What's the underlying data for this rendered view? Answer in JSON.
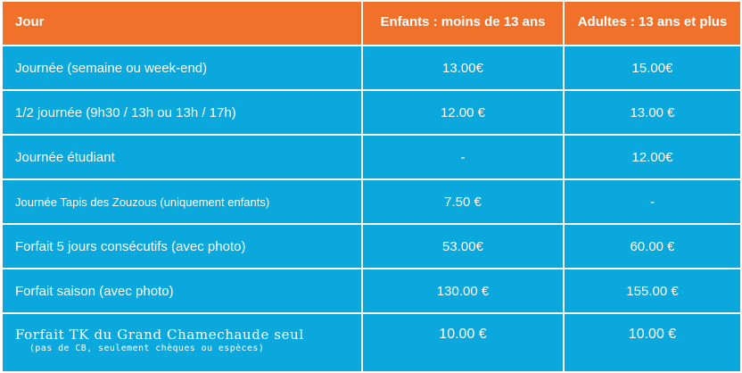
{
  "table": {
    "headers": [
      "Jour",
      "Enfants :  moins de 13 ans",
      "Adultes : 13 ans et plus"
    ],
    "rows": [
      {
        "label": "Journée (semaine ou week-end)",
        "enfants": "13.00€",
        "adultes": "15.00€"
      },
      {
        "label": "1/2 journée (9h30 / 13h ou 13h / 17h)",
        "enfants": "12.00 €",
        "adultes": "13.00 €"
      },
      {
        "label": "Journée étudiant",
        "enfants": "-",
        "adultes": "12.00€"
      },
      {
        "label": "Journée Tapis des Zouzous (uniquement enfants)",
        "enfants": "7.50 €",
        "adultes": "-"
      },
      {
        "label": "Forfait 5 jours consécutifs (avec photo)",
        "enfants": "53.00€",
        "adultes": "60.00 €"
      },
      {
        "label": "Forfait saison (avec photo)",
        "enfants": "130.00 €",
        "adultes": "155.00 €"
      },
      {
        "label": "Forfait TK du Grand Chamechaude seul",
        "note": "(pas de CB, seulement chèques ou espèces)",
        "enfants": "10.00 €",
        "adultes": "10.00 €"
      }
    ]
  },
  "colors": {
    "header_bg": "#f1712a",
    "row_bg": "#0aa8dc",
    "text": "#ffffff"
  }
}
